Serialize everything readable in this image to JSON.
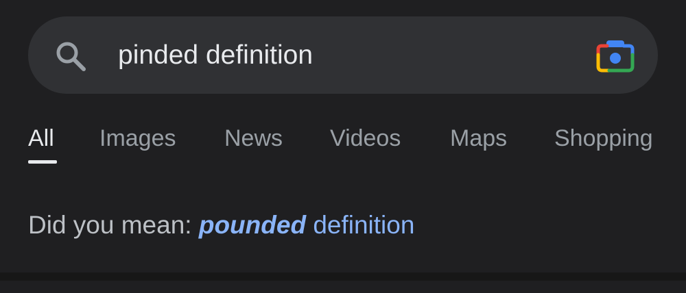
{
  "search": {
    "query": "pinded definition",
    "search_icon": "search-icon",
    "lens_icon": "google-lens-camera-icon"
  },
  "tabs": [
    {
      "label": "All",
      "active": true
    },
    {
      "label": "Images",
      "active": false
    },
    {
      "label": "News",
      "active": false
    },
    {
      "label": "Videos",
      "active": false
    },
    {
      "label": "Maps",
      "active": false
    },
    {
      "label": "Shopping",
      "active": false
    }
  ],
  "suggestion": {
    "prefix": "Did you mean:",
    "corrected_word": "pounded",
    "rest": "definition"
  },
  "colors": {
    "background": "#1f1f21",
    "search_bar": "#303134",
    "link": "#8ab4f8",
    "tab_inactive": "#9aa0a6",
    "tab_active": "#e8eaed"
  }
}
